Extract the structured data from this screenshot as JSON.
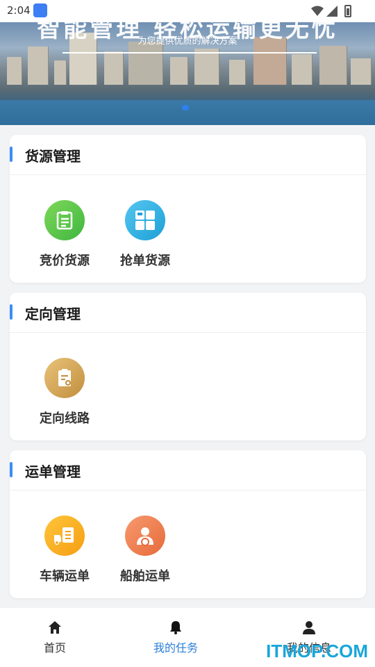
{
  "status_bar": {
    "time": "2:04"
  },
  "banner": {
    "title": "智能管理 轻松运输更无忧",
    "subtitle": "为您提供优质的解决方案"
  },
  "sections": [
    {
      "title": "货源管理",
      "items": [
        {
          "label": "竞价货源",
          "icon": "clipboard-list-icon"
        },
        {
          "label": "抢单货源",
          "icon": "bus-grid-icon"
        }
      ]
    },
    {
      "title": "定向管理",
      "items": [
        {
          "label": "定向线路",
          "icon": "route-document-icon"
        }
      ]
    },
    {
      "title": "运单管理",
      "items": [
        {
          "label": "车辆运单",
          "icon": "truck-document-icon"
        },
        {
          "label": "船舶运单",
          "icon": "driver-person-icon"
        }
      ]
    }
  ],
  "tabbar": {
    "home": "首页",
    "tasks": "我的任务",
    "profile": "我的信息"
  },
  "watermark": "ITMOP.COM",
  "colors": {
    "accent": "#3a8ef6",
    "active_tab": "#2a7fd8"
  }
}
